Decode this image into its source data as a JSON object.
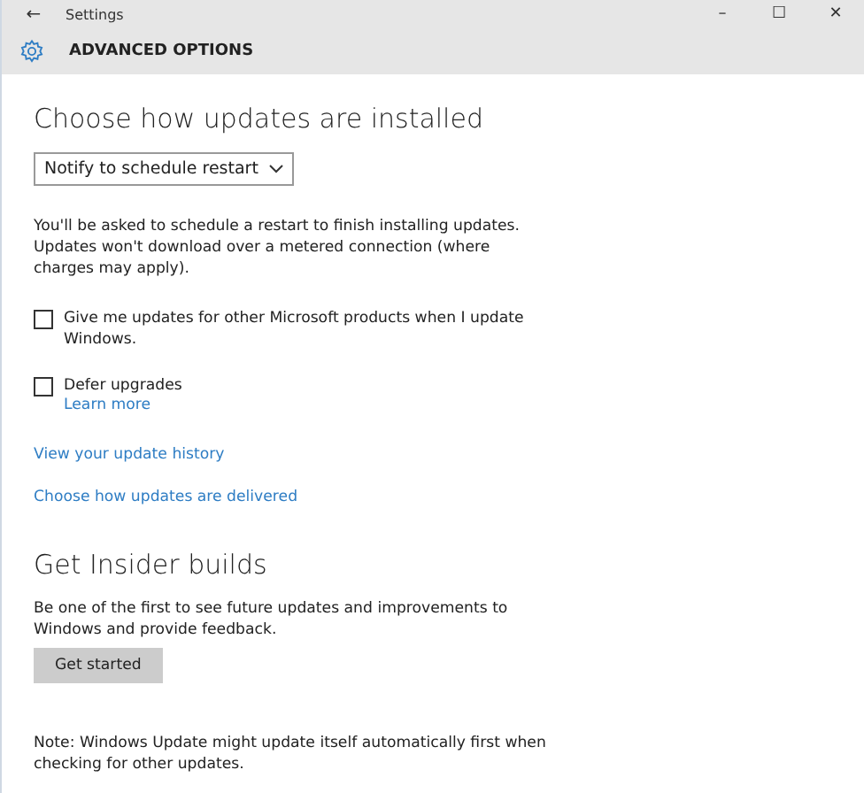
{
  "window": {
    "title": "Settings",
    "back": "←",
    "controls": [
      "–",
      "☐",
      "✕"
    ]
  },
  "header": {
    "title": "ADVANCED OPTIONS"
  },
  "install": {
    "heading": "Choose how updates are installed",
    "dropdown": {
      "value": "Notify to schedule restart"
    },
    "description": "You'll be asked to schedule a restart to finish installing updates. Updates won't download over a metered connection (where charges may apply).",
    "options": [
      {
        "label": "Give me updates for other Microsoft products when I update Windows.",
        "checked": false
      },
      {
        "label": "Defer upgrades",
        "checked": false,
        "link": "Learn more"
      }
    ],
    "links": [
      "View your update history",
      "Choose how updates are delivered"
    ]
  },
  "insider": {
    "heading": "Get Insider builds",
    "description": "Be one of the first to see future updates and improvements to Windows and provide feedback.",
    "button": "Get started"
  },
  "note": "Note: Windows Update might update itself automatically first when checking for other updates."
}
